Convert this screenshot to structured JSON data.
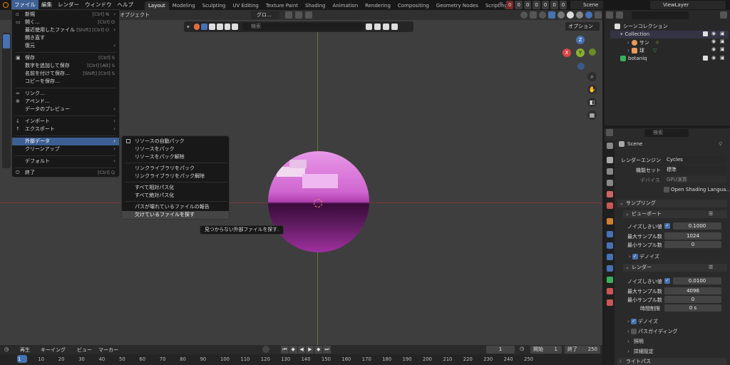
{
  "menubar": {
    "items": [
      "ファイル",
      "編集",
      "レンダー",
      "ウィンドウ",
      "ヘルプ"
    ],
    "workspaces": [
      "Layout",
      "Modeling",
      "Sculpting",
      "UV Editing",
      "Texture Paint",
      "Shading",
      "Animation",
      "Rendering",
      "Compositing",
      "Geometry Nodes",
      "Scripting"
    ],
    "plus": "+",
    "counters": [
      "0",
      "0",
      "0",
      "0",
      "0",
      "0",
      "0"
    ],
    "scene": "Scene",
    "viewlayer": "ViewLayer"
  },
  "viewport": {
    "mode": "オブジェクト",
    "orientation": "グロ…",
    "search_placeholder": "検索",
    "options": "オプション",
    "gizmo": {
      "x": "X",
      "y": "Y",
      "z": "Z"
    }
  },
  "file_menu": {
    "items": [
      {
        "label": "新規",
        "shortcut": "[Ctrl] N",
        "arrow": "›"
      },
      {
        "label": "開く…",
        "shortcut": "[Ctrl] O"
      },
      {
        "label": "最近使用したファイル",
        "shortcut": "[Shift] [Ctrl] O",
        "arrow": "›"
      },
      {
        "label": "開き直す",
        "shortcut": ""
      },
      {
        "label": "復元",
        "shortcut": "",
        "arrow": "›"
      },
      {
        "label": "保存",
        "shortcut": "[Ctrl] S"
      },
      {
        "label": "数字を追加して保存",
        "shortcut": "[Ctrl] [Alt] S"
      },
      {
        "label": "名前を付けて保存…",
        "shortcut": "[Shift] [Ctrl] S"
      },
      {
        "label": "コピーを保存…",
        "shortcut": ""
      },
      {
        "label": "リンク…",
        "shortcut": ""
      },
      {
        "label": "アペンド…",
        "shortcut": ""
      },
      {
        "label": "データのプレビュー",
        "shortcut": "",
        "arrow": "›"
      },
      {
        "label": "インポート",
        "shortcut": "",
        "arrow": "›"
      },
      {
        "label": "エクスポート",
        "shortcut": "",
        "arrow": "›"
      },
      {
        "label": "外部データ",
        "shortcut": "",
        "arrow": "›"
      },
      {
        "label": "クリーンアップ",
        "shortcut": "",
        "arrow": "›"
      },
      {
        "label": "デフォルト",
        "shortcut": "",
        "arrow": "›"
      },
      {
        "label": "終了",
        "shortcut": "[Ctrl] Q"
      }
    ]
  },
  "external_data_menu": {
    "items": [
      "リソースの自動パック",
      "リソースをパック",
      "リソースをパック解除",
      "リンクライブラリをパック",
      "リンクライブラリをパック解除",
      "すべて相対パス化",
      "すべて絶対パス化",
      "パスが壊れているファイルの報告",
      "欠けているファイルを探す"
    ]
  },
  "tooltip": "見つからない外部ファイルを探す.",
  "outliner": {
    "scene_collection": "シーンコレクション",
    "collection": "Collection",
    "items": [
      "サン",
      "球"
    ],
    "botaniq": "botaniq"
  },
  "properties": {
    "search_placeholder": "検索",
    "scene": "Scene",
    "render_engine_label": "レンダーエンジン",
    "render_engine": "Cycles",
    "feature_set_label": "機能セット",
    "feature_set": "標準",
    "device_label": "デバイス",
    "device": "GPU演算",
    "osl": "Open Shading Langua…",
    "sampling": "サンプリング",
    "viewport": "ビューポート",
    "noise_threshold_label": "ノイズしきい値",
    "vp_noise_threshold": "0.1000",
    "max_samples_label": "最大サンプル数",
    "vp_max_samples": "1024",
    "min_samples_label": "最小サンプル数",
    "vp_min_samples": "0",
    "denoise": "デノイズ",
    "render": "レンダー",
    "r_noise_threshold": "0.0100",
    "r_max_samples": "4096",
    "r_min_samples": "0",
    "time_limit_label": "時間制限",
    "time_limit": "0 s",
    "path_guiding": "パスガイディング",
    "lights": "照明",
    "advanced": "詳細設定",
    "light_paths": "ライトパス"
  },
  "timeline": {
    "playback": "再生",
    "keying": "キーイング",
    "view": "ビュー",
    "marker": "マーカー",
    "current_frame": "1",
    "start_label": "開始",
    "start": "1",
    "end_label": "終了",
    "end": "250",
    "ticks": [
      "1",
      "10",
      "20",
      "30",
      "40",
      "50",
      "60",
      "70",
      "80",
      "90",
      "100",
      "110",
      "120",
      "130",
      "140",
      "150",
      "160",
      "170",
      "180",
      "190",
      "200",
      "210",
      "220",
      "230",
      "240",
      "250"
    ]
  },
  "colors": {
    "accent": "#3e5f93",
    "sphere_top": "#e07be0",
    "sphere_bottom": "#3a0a3a",
    "selected_blue": "#4772b3"
  }
}
